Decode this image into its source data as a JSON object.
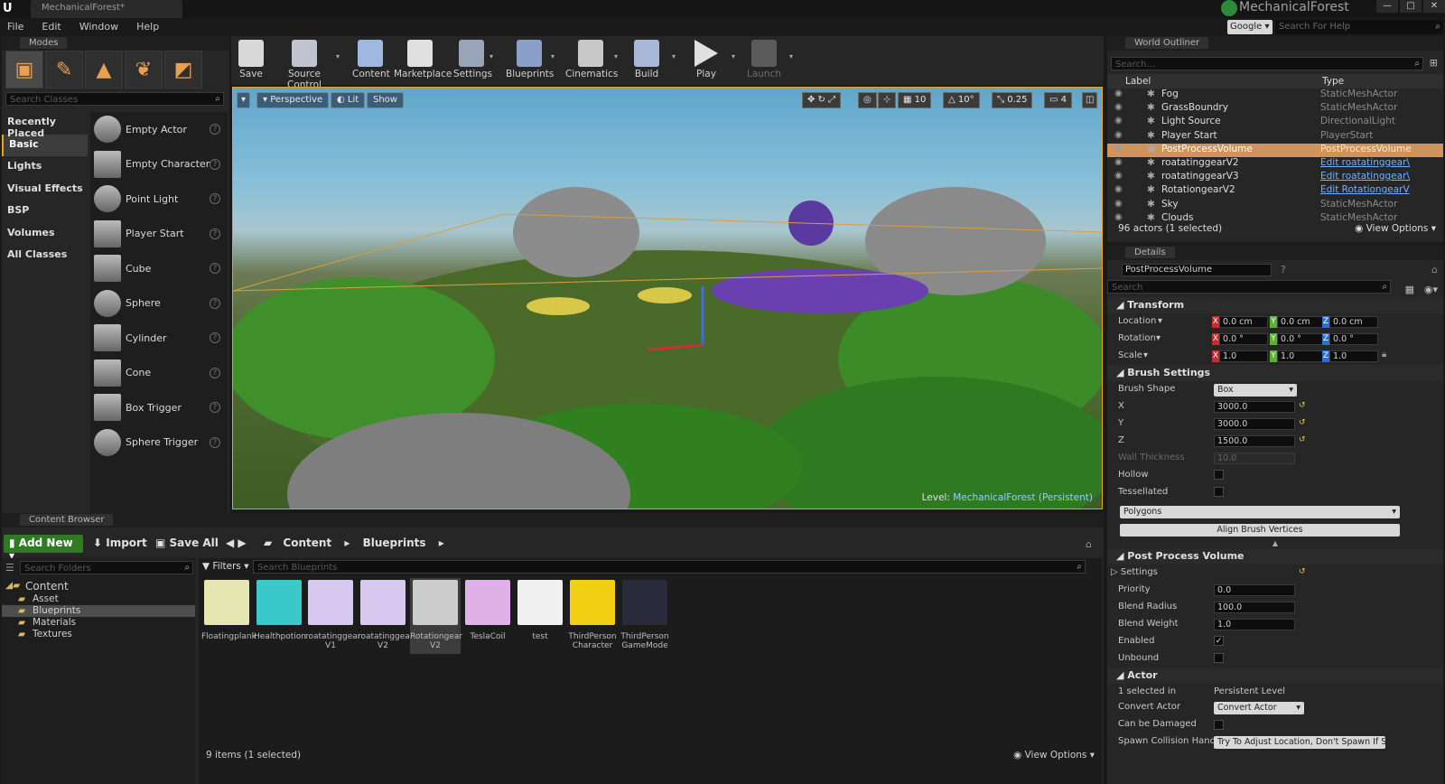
{
  "window": {
    "tab_title": "MechanicalForest*",
    "project_name": "MechanicalForest",
    "logo": "U",
    "search_provider": "Google",
    "help_search_placeholder": "Search For Help"
  },
  "menu": [
    "File",
    "Edit",
    "Window",
    "Help"
  ],
  "modes": {
    "title": "Modes",
    "search_placeholder": "Search Classes",
    "categories": [
      "Recently Placed",
      "Basic",
      "Lights",
      "Visual Effects",
      "BSP",
      "Volumes",
      "All Classes"
    ],
    "selected_category": "Basic",
    "items": [
      "Empty Actor",
      "Empty Character",
      "Point Light",
      "Player Start",
      "Cube",
      "Sphere",
      "Cylinder",
      "Cone",
      "Box Trigger",
      "Sphere Trigger"
    ]
  },
  "toolbar": {
    "buttons": [
      "Save",
      "Source Control",
      "Content",
      "Marketplace",
      "Settings",
      "Blueprints",
      "Cinematics",
      "Build",
      "Play",
      "Launch"
    ]
  },
  "viewport": {
    "perspective": "Perspective",
    "lit": "Lit",
    "show": "Show",
    "grid_snap": "10",
    "rotation_snap": "10°",
    "scale_snap": "0.25",
    "camera_speed": "4",
    "level_prefix": "Level:",
    "level_name": "MechanicalForest (Persistent)"
  },
  "outliner": {
    "title": "World Outliner",
    "search_placeholder": "Search...",
    "col_label": "Label",
    "col_type": "Type",
    "rows": [
      {
        "label": "Fog",
        "type": "StaticMeshActor",
        "link": false,
        "selected": false
      },
      {
        "label": "GrassBoundry",
        "type": "StaticMeshActor",
        "link": false,
        "selected": false
      },
      {
        "label": "Light Source",
        "type": "DirectionalLight",
        "link": false,
        "selected": false
      },
      {
        "label": "Player Start",
        "type": "PlayerStart",
        "link": false,
        "selected": false
      },
      {
        "label": "PostProcessVolume",
        "type": "PostProcessVolume",
        "link": false,
        "selected": true
      },
      {
        "label": "roatatinggearV2",
        "type": "Edit roatatinggear\\",
        "link": true,
        "selected": false
      },
      {
        "label": "roatatinggearV3",
        "type": "Edit roatatinggear\\",
        "link": true,
        "selected": false
      },
      {
        "label": "RotationgearV2",
        "type": "Edit RotationgearV",
        "link": true,
        "selected": false
      },
      {
        "label": "Sky",
        "type": "StaticMeshActor",
        "link": false,
        "selected": false
      },
      {
        "label": "Clouds",
        "type": "StaticMeshActor",
        "link": false,
        "selected": false
      }
    ],
    "status": "96 actors (1 selected)",
    "view_options": "View Options"
  },
  "details": {
    "title": "Details",
    "actor_name": "PostProcessVolume",
    "search_placeholder": "Search",
    "transform": {
      "header": "Transform",
      "location_label": "Location",
      "rotation_label": "Rotation",
      "scale_label": "Scale",
      "location": [
        "0.0 cm",
        "0.0 cm",
        "0.0 cm"
      ],
      "rotation": [
        "0.0 °",
        "0.0 °",
        "0.0 °"
      ],
      "scale": [
        "1.0",
        "1.0",
        "1.0"
      ]
    },
    "brush": {
      "header": "Brush Settings",
      "shape_label": "Brush Shape",
      "shape": "Box",
      "x_label": "X",
      "x": "3000.0",
      "y_label": "Y",
      "y": "3000.0",
      "z_label": "Z",
      "z": "1500.0",
      "wall_label": "Wall Thickness",
      "wall": "10.0",
      "hollow_label": "Hollow",
      "tess_label": "Tessellated",
      "polygons": "Polygons",
      "align_button": "Align Brush Vertices"
    },
    "ppv": {
      "header": "Post Process Volume",
      "settings_label": "Settings",
      "priority_label": "Priority",
      "priority": "0.0",
      "radius_label": "Blend Radius",
      "radius": "100.0",
      "weight_label": "Blend Weight",
      "weight": "1.0",
      "enabled_label": "Enabled",
      "unbound_label": "Unbound"
    },
    "actor": {
      "header": "Actor",
      "selected_label": "1 selected in",
      "selected_value": "Persistent Level",
      "convert_label": "Convert Actor",
      "convert_value": "Convert Actor",
      "damaged_label": "Can be Damaged",
      "spawn_label": "Spawn Collision Handlin",
      "spawn_value": "Try To Adjust Location, Don't Spawn If Still"
    }
  },
  "content_browser": {
    "title": "Content Browser",
    "add_new": "Add New",
    "import": "Import",
    "save_all": "Save All",
    "path": [
      "Content",
      "Blueprints"
    ],
    "folder_search_placeholder": "Search Folders",
    "asset_search_placeholder": "Search Blueprints",
    "filters": "Filters",
    "folders": [
      {
        "name": "Content",
        "level": 0,
        "selected": false
      },
      {
        "name": "Asset",
        "level": 1,
        "selected": false
      },
      {
        "name": "Blueprints",
        "level": 1,
        "selected": true
      },
      {
        "name": "Materials",
        "level": 1,
        "selected": false
      },
      {
        "name": "Textures",
        "level": 1,
        "selected": false
      }
    ],
    "assets": [
      {
        "name": "Floatingplank",
        "name2": ""
      },
      {
        "name": "Healthpotion",
        "name2": ""
      },
      {
        "name": "roatatinggear",
        "name2": "V1"
      },
      {
        "name": "roatatinggear",
        "name2": "V2"
      },
      {
        "name": "Rotationgear",
        "name2": "V2"
      },
      {
        "name": "TeslaCoil",
        "name2": ""
      },
      {
        "name": "test",
        "name2": ""
      },
      {
        "name": "ThirdPerson",
        "name2": "Character"
      },
      {
        "name": "ThirdPerson",
        "name2": "GameMode"
      }
    ],
    "status": "9 items (1 selected)",
    "view_options": "View Options"
  }
}
